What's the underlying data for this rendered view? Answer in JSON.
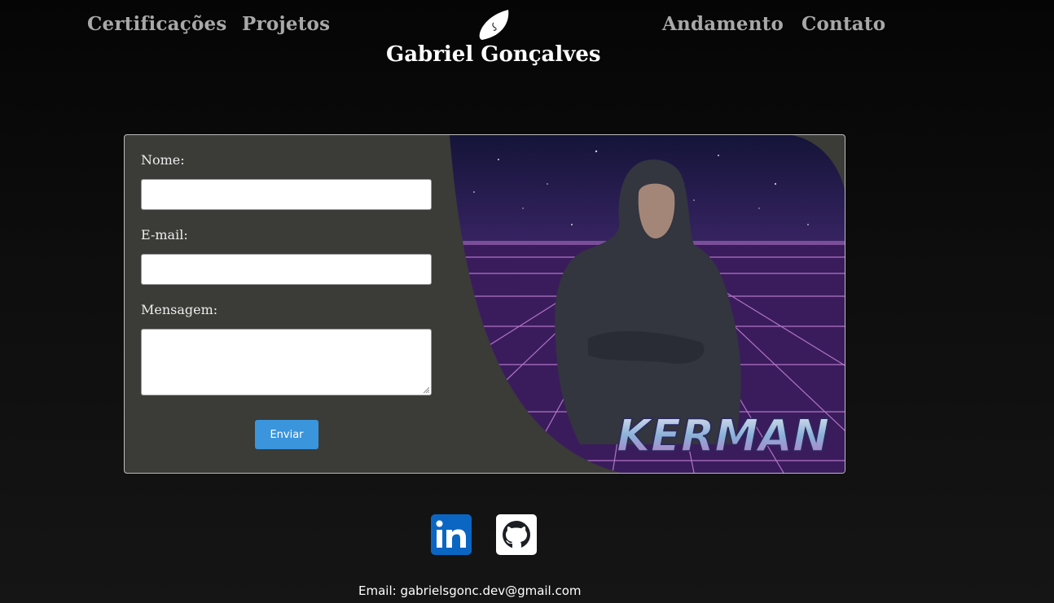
{
  "nav": {
    "items": [
      {
        "label": "Certificações"
      },
      {
        "label": "Projetos"
      },
      {
        "label": "Andamento"
      },
      {
        "label": "Contato"
      }
    ]
  },
  "brand": {
    "name": "Gabriel Gonçalves",
    "logo_icon": "leaf-logo-icon"
  },
  "form": {
    "name_label": "Nome:",
    "email_label": "E-mail:",
    "message_label": "Mensagem:",
    "name_value": "",
    "email_value": "",
    "message_value": "",
    "submit_label": "Enviar"
  },
  "hero_image": {
    "overlay_text": "KERMAN"
  },
  "social": {
    "links": [
      {
        "icon": "linkedin-icon"
      },
      {
        "icon": "github-icon"
      }
    ]
  },
  "footer": {
    "email_text": "Email: gabrielsgonc.dev@gmail.com"
  },
  "colors": {
    "background": "#0b0b0b",
    "nav_text": "#a8a8a8",
    "card_bg": "#3b3b37",
    "button": "#3a95dc",
    "linkedin": "#0a66c2"
  }
}
